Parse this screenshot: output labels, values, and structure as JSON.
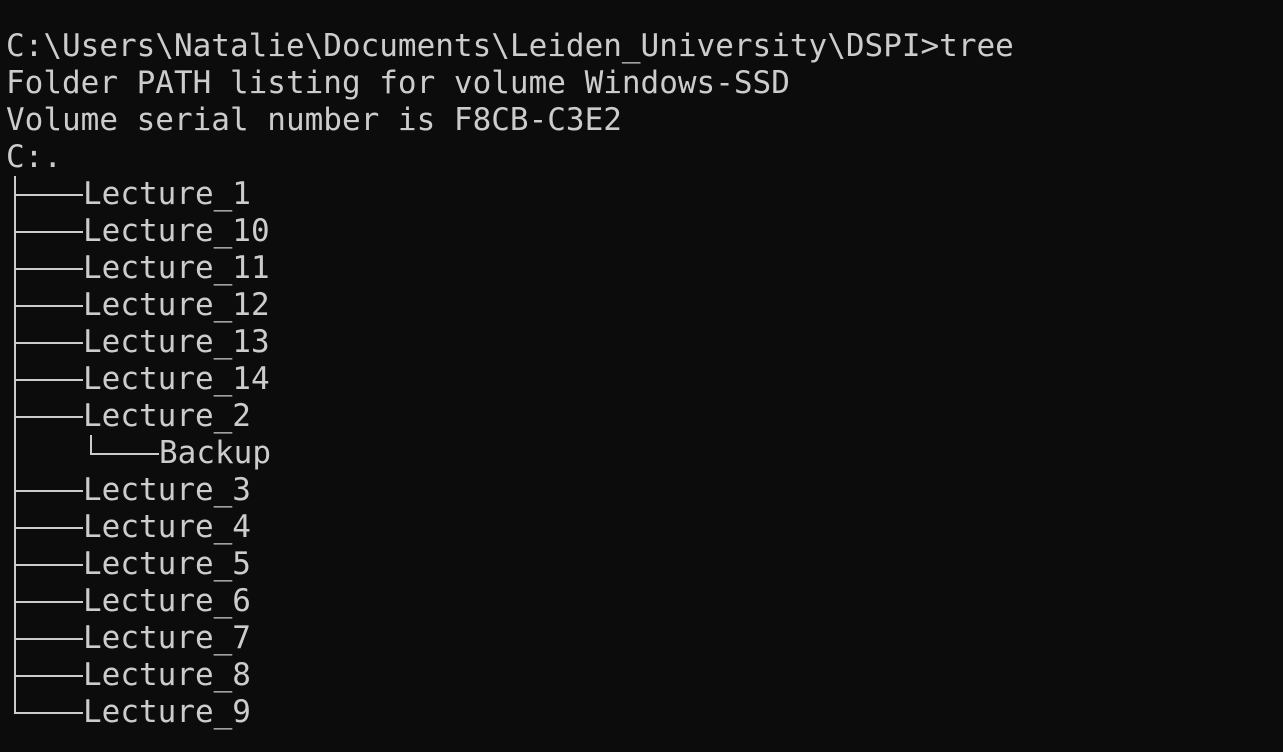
{
  "terminal": {
    "prompt": "C:\\Users\\Natalie\\Documents\\Leiden_University\\DSPI>tree",
    "header_line1": "Folder PATH listing for volume Windows-SSD",
    "header_line2": "Volume serial number is F8CB-C3E2",
    "root": "C:.",
    "folders": [
      {
        "name": "Lecture_1"
      },
      {
        "name": "Lecture_10"
      },
      {
        "name": "Lecture_11"
      },
      {
        "name": "Lecture_12"
      },
      {
        "name": "Lecture_13"
      },
      {
        "name": "Lecture_14"
      },
      {
        "name": "Lecture_2",
        "children": [
          {
            "name": "Backup"
          }
        ]
      },
      {
        "name": "Lecture_3"
      },
      {
        "name": "Lecture_4"
      },
      {
        "name": "Lecture_5"
      },
      {
        "name": "Lecture_6"
      },
      {
        "name": "Lecture_7"
      },
      {
        "name": "Lecture_8"
      },
      {
        "name": "Lecture_9"
      }
    ]
  },
  "colors": {
    "background": "#0c0c0c",
    "foreground": "#cccccc"
  }
}
